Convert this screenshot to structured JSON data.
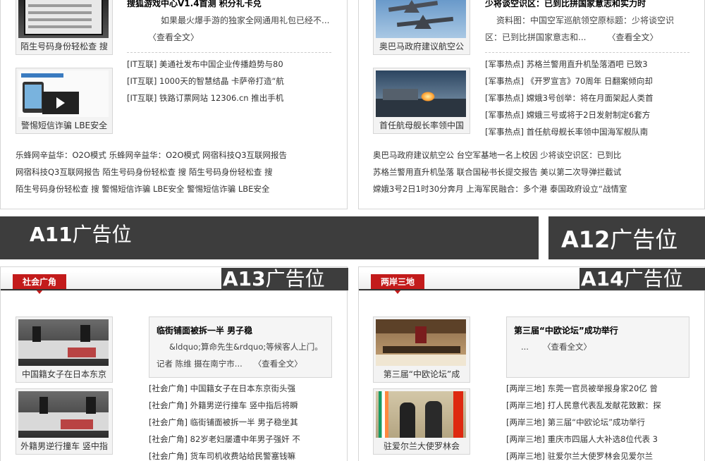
{
  "tl": {
    "feat_title": "搜狐游戏中心V1.4首测 积分礼卡兑",
    "feat_desc": "如果最火爆手游的独家全网通用礼包已经不...",
    "more": "〈查看全文〉",
    "thumbs": [
      "陌生号码身份轻松查 搜",
      "警惕短信诈骗 LBE安全"
    ],
    "list": [
      {
        "tag": "[IT互联]",
        "text": "美通社发布中国企业传播趋势与80"
      },
      {
        "tag": "[IT互联]",
        "text": "1000天的智慧结晶 卡萨帝打造“航"
      },
      {
        "tag": "[IT互联]",
        "text": "铁路订票网站 12306.cn 推出手机"
      }
    ],
    "links": [
      "乐蜂网辛益华：O2O模式 乐蜂网辛益华：O2O模式 网宿科技Q3互联网报告",
      "网宿科技Q3互联网报告 陌生号码身份轻松查 搜 陌生号码身份轻松查 搜",
      "陌生号码身份轻松查 搜 警惕短信诈骗 LBE安全 警惕短信诈骗 LBE安全"
    ]
  },
  "tr": {
    "feat_title": "少将谈空识区：已到比拼国家意志和实力时",
    "feat_desc": "资料图：中国空军巡航领空原标题：少将谈空识区：已到比拼国家意志和...",
    "more": "〈查看全文〉",
    "thumbs": [
      "奥巴马政府建议航空公",
      "首任航母舰长率领中国"
    ],
    "list": [
      {
        "tag": "[军事热点]",
        "text": "苏格兰警用直升机坠落酒吧 已致3"
      },
      {
        "tag": "[军事热点]",
        "text": "《开罗宣言》70周年 日翻案倾向却"
      },
      {
        "tag": "[军事热点]",
        "text": "嫦娥3号创举：将在月面架起人类首"
      },
      {
        "tag": "[军事热点]",
        "text": "嫦娥三号或将于2日发射制定6套方"
      },
      {
        "tag": "[军事热点]",
        "text": "首任航母舰长率领中国海军舰队南"
      }
    ],
    "links": [
      "奥巴马政府建议航空公 台空军基地一名上校因 少将谈空识区：已到比",
      "苏格兰警用直升机坠落 联合国秘书长提交报告 美以第二次导弹拦截试",
      "嫦娥3号2日1时30分奔月 上海军民融合：多个港 泰国政府设立“战情室"
    ]
  },
  "ads": {
    "a11": {
      "code": "A11",
      "word": "广告位"
    },
    "a12": {
      "code": "A12",
      "word": "广告位"
    },
    "a13": {
      "code": "A13",
      "word": "广告位"
    },
    "a14": {
      "code": "A14",
      "word": "广告位"
    }
  },
  "bl": {
    "section": "社会广角",
    "feat_title": "临街铺面被拆一半 男子稳",
    "feat_desc": "&ldquo;算命先生&rdquo;等候客人上门。记者 陈维 摄在南宁市...",
    "more": "〈查看全文〉",
    "thumbs": [
      "中国籍女子在日本东京",
      "外籍男逆行撞车 竖中指"
    ],
    "list": [
      {
        "tag": "[社会广角]",
        "text": "中国籍女子在日本东京街头强"
      },
      {
        "tag": "[社会广角]",
        "text": "外籍男逆行撞车 竖中指后将瞬"
      },
      {
        "tag": "[社会广角]",
        "text": "临街铺面被拆一半 男子稳坐其"
      },
      {
        "tag": "[社会广角]",
        "text": "82岁老妇屡遭中年男子强奸 不"
      },
      {
        "tag": "[社会广角]",
        "text": "货车司机收费站给民警塞钱嘛"
      }
    ]
  },
  "br": {
    "section": "两岸三地",
    "feat_title": "第三届“中欧论坛”成功举行",
    "feat_desc": "...",
    "more": "〈查看全文〉",
    "thumbs": [
      "第三届“中欧论坛”成",
      "驻爱尔兰大使罗林会"
    ],
    "list": [
      {
        "tag": "[两岸三地]",
        "text": "东莞一官员被举报身家20亿 曾"
      },
      {
        "tag": "[两岸三地]",
        "text": "打人民意代表乱发献花致歉：探"
      },
      {
        "tag": "[两岸三地]",
        "text": "第三届“中欧论坛”成功举行"
      },
      {
        "tag": "[两岸三地]",
        "text": "重庆市四届人大补选8位代表 3"
      },
      {
        "tag": "[两岸三地]",
        "text": "驻爱尔兰大使罗林会见爱尔兰"
      }
    ]
  },
  "colors": {
    "accent_red": "#c31b1b",
    "ad_bar": "#3d3d3d"
  }
}
